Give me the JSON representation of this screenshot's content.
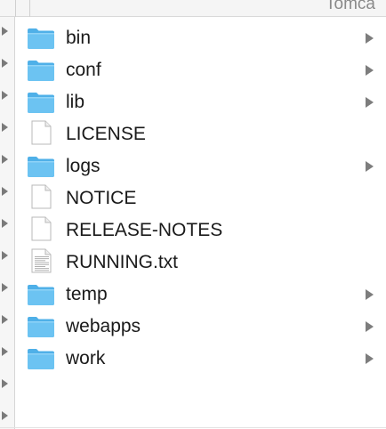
{
  "column_header": {
    "title": "Tomca"
  },
  "files": [
    {
      "name": "bin",
      "kind": "folder",
      "icon": "folder-icon",
      "has_children": true
    },
    {
      "name": "conf",
      "kind": "folder",
      "icon": "folder-icon",
      "has_children": true
    },
    {
      "name": "lib",
      "kind": "folder",
      "icon": "folder-icon",
      "has_children": true
    },
    {
      "name": "LICENSE",
      "kind": "document",
      "icon": "blank-document-icon",
      "has_children": false
    },
    {
      "name": "logs",
      "kind": "folder",
      "icon": "folder-icon",
      "has_children": true
    },
    {
      "name": "NOTICE",
      "kind": "document",
      "icon": "blank-document-icon",
      "has_children": false
    },
    {
      "name": "RELEASE-NOTES",
      "kind": "document",
      "icon": "blank-document-icon",
      "has_children": false
    },
    {
      "name": "RUNNING.txt",
      "kind": "text",
      "icon": "text-document-icon",
      "has_children": false
    },
    {
      "name": "temp",
      "kind": "folder",
      "icon": "folder-icon",
      "has_children": true
    },
    {
      "name": "webapps",
      "kind": "folder",
      "icon": "folder-icon",
      "has_children": true
    },
    {
      "name": "work",
      "kind": "folder",
      "icon": "folder-icon",
      "has_children": true
    }
  ],
  "colors": {
    "folder": "#6cc3f2",
    "folder_tab": "#4fb0e8",
    "chevron": "#7d7d7d"
  }
}
